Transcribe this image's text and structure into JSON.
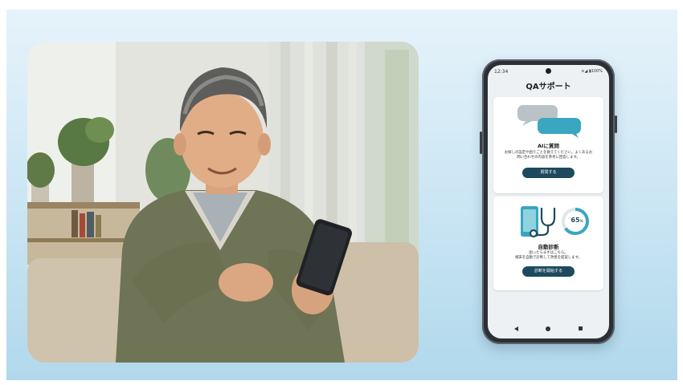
{
  "phone": {
    "status_time": "12:34",
    "status_icons": "≋◢ ▮100%",
    "app_title": "QAサポート",
    "ai_card": {
      "title": "AIに質問",
      "description_line1": "お探しの設定や困りごとを教えてください。よくあるお",
      "description_line2": "問い合わせの内容を参考に回答します。",
      "button": "質問する",
      "icon": "chat-bubbles-icon"
    },
    "diag_card": {
      "title": "自動診断",
      "description_line1": "困ったらまずはこちら。",
      "description_line2": "端末を自動で診断して改善を提案します。",
      "button": "診断を開始する",
      "gauge_value": "65",
      "gauge_unit": "%",
      "gauge_fraction": 0.65,
      "icons": [
        "phone-icon",
        "stethoscope-icon",
        "gauge-icon"
      ]
    },
    "nav": [
      "back-icon",
      "home-icon",
      "recent-apps-icon"
    ]
  },
  "colors": {
    "banner_top": "#e6f3fb",
    "banner_bottom": "#b1d8ec",
    "accent_dark": "#1d4a5e",
    "accent_teal": "#3aa6bf",
    "bubble_gray": "#b9c3c7"
  }
}
